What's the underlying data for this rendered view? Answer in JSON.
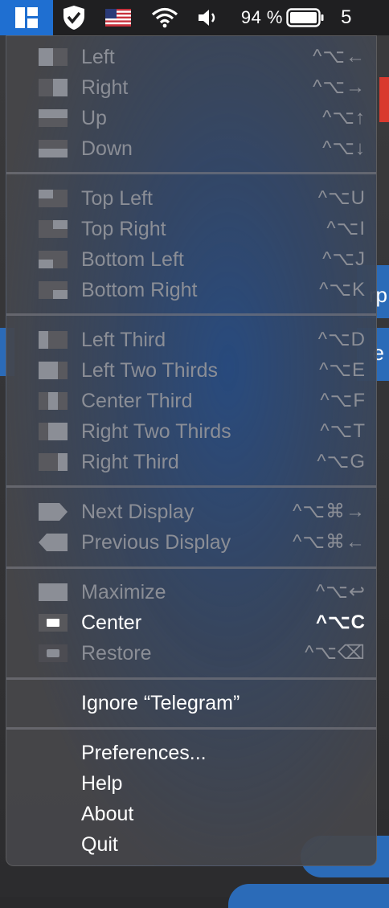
{
  "menubar": {
    "battery_percent": "94 %",
    "battery_level": 0.94,
    "clock_partial": "5",
    "icons": [
      "rectangle-app-icon",
      "shield-check-icon",
      "us-flag-icon",
      "wifi-icon",
      "volume-icon",
      "battery-icon"
    ]
  },
  "menu": {
    "left": {
      "label": "Left",
      "shortcut": "^⌥←"
    },
    "right": {
      "label": "Right",
      "shortcut": "^⌥→"
    },
    "up": {
      "label": "Up",
      "shortcut": "^⌥↑"
    },
    "down": {
      "label": "Down",
      "shortcut": "^⌥↓"
    },
    "top_left": {
      "label": "Top Left",
      "shortcut": "^⌥U"
    },
    "top_right": {
      "label": "Top Right",
      "shortcut": "^⌥I"
    },
    "bottom_left": {
      "label": "Bottom Left",
      "shortcut": "^⌥J"
    },
    "bottom_right": {
      "label": "Bottom Right",
      "shortcut": "^⌥K"
    },
    "left_third": {
      "label": "Left Third",
      "shortcut": "^⌥D"
    },
    "left_two_thirds": {
      "label": "Left Two Thirds",
      "shortcut": "^⌥E"
    },
    "center_third": {
      "label": "Center Third",
      "shortcut": "^⌥F"
    },
    "right_two_thirds": {
      "label": "Right Two Thirds",
      "shortcut": "^⌥T"
    },
    "right_third": {
      "label": "Right Third",
      "shortcut": "^⌥G"
    },
    "next_display": {
      "label": "Next Display",
      "shortcut": "^⌥⌘→"
    },
    "previous_display": {
      "label": "Previous Display",
      "shortcut": "^⌥⌘←"
    },
    "maximize": {
      "label": "Maximize",
      "shortcut": "^⌥↩"
    },
    "center": {
      "label": "Center",
      "shortcut": "^⌥C"
    },
    "restore": {
      "label": "Restore",
      "shortcut": "^⌥⌫"
    },
    "ignore": {
      "label": "Ignore “Telegram”"
    },
    "preferences": {
      "label": "Preferences..."
    },
    "help": {
      "label": "Help"
    },
    "about": {
      "label": "About"
    },
    "quit": {
      "label": "Quit"
    }
  },
  "background": {
    "text_right_1": "rp",
    "text_right_2": "e"
  },
  "colors": {
    "accent": "#1f6fd1",
    "menubar_bg": "#1f1f21",
    "disabled_text": "#8b8e96",
    "enabled_text": "#ffffff"
  }
}
